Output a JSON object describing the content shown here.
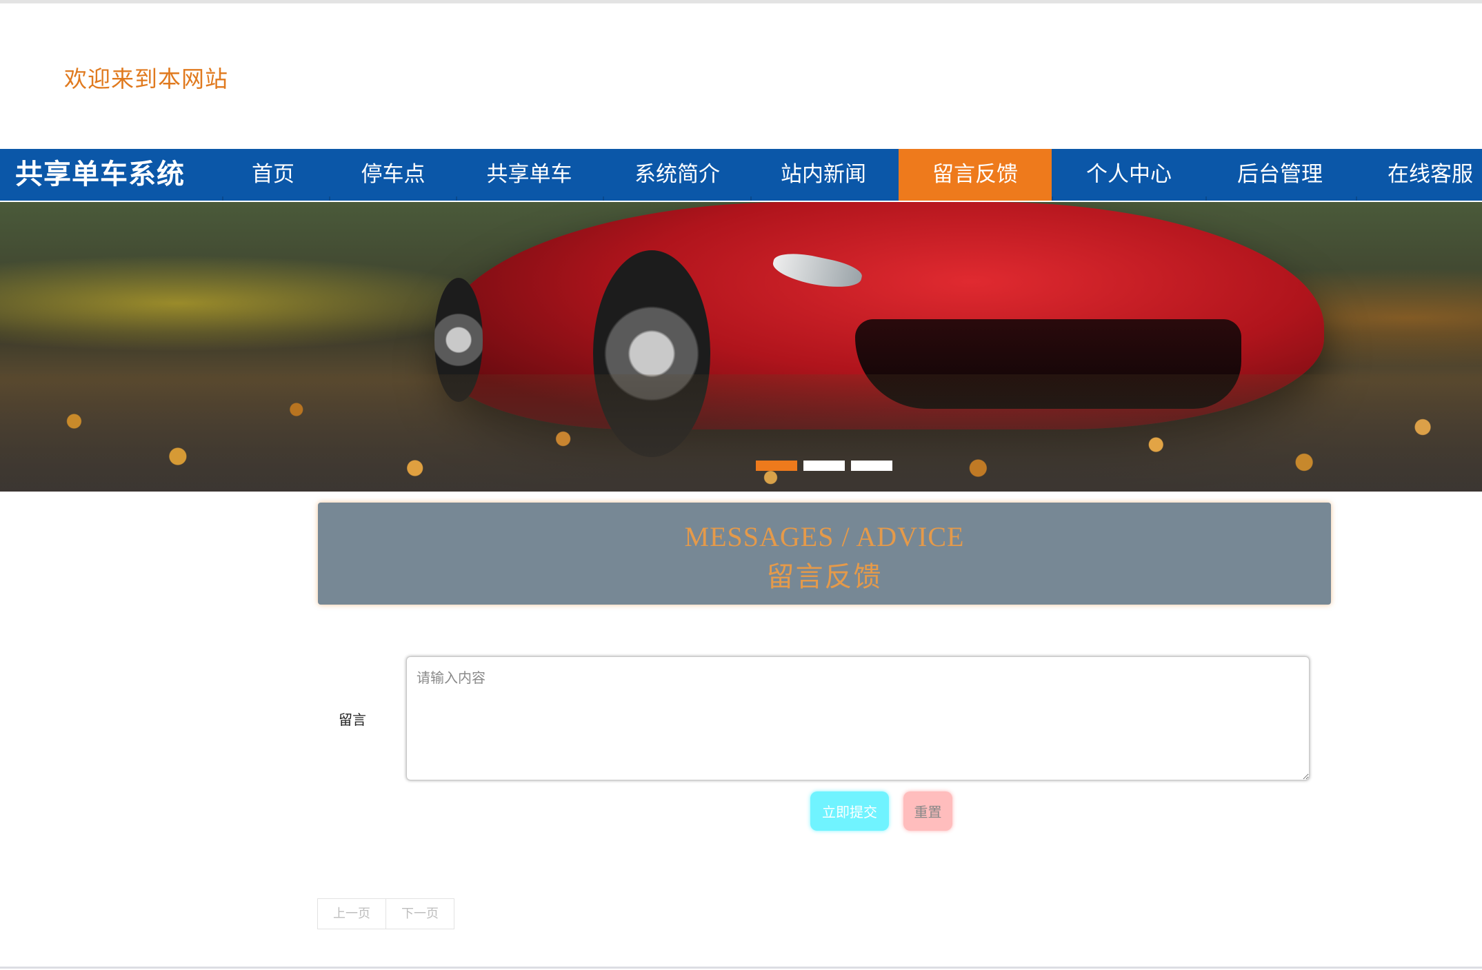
{
  "header": {
    "welcome_text": "欢迎来到本网站"
  },
  "navbar": {
    "brand": "共享单车系统",
    "items": [
      {
        "label": "首页"
      },
      {
        "label": "停车点"
      },
      {
        "label": "共享单车"
      },
      {
        "label": "系统简介"
      },
      {
        "label": "站内新闻"
      },
      {
        "label": "留言反馈",
        "active": true
      },
      {
        "label": "个人中心"
      },
      {
        "label": "后台管理"
      },
      {
        "label": "在线客服"
      }
    ]
  },
  "banner": {
    "slide_count": 3,
    "active_slide": 1
  },
  "section": {
    "title_en": "MESSAGES / ADVICE",
    "title_cn": "留言反馈"
  },
  "form": {
    "message_label": "留言",
    "message_placeholder": "请输入内容",
    "message_value": "",
    "submit_label": "立即提交",
    "reset_label": "重置"
  },
  "pagination": {
    "prev_label": "上一页",
    "next_label": "下一页"
  },
  "colors": {
    "nav_bg": "#0b57a8",
    "accent": "#ee7a1c",
    "title_box": "#778895",
    "submit": "#70f3ff",
    "reset": "#ffbdbd"
  }
}
